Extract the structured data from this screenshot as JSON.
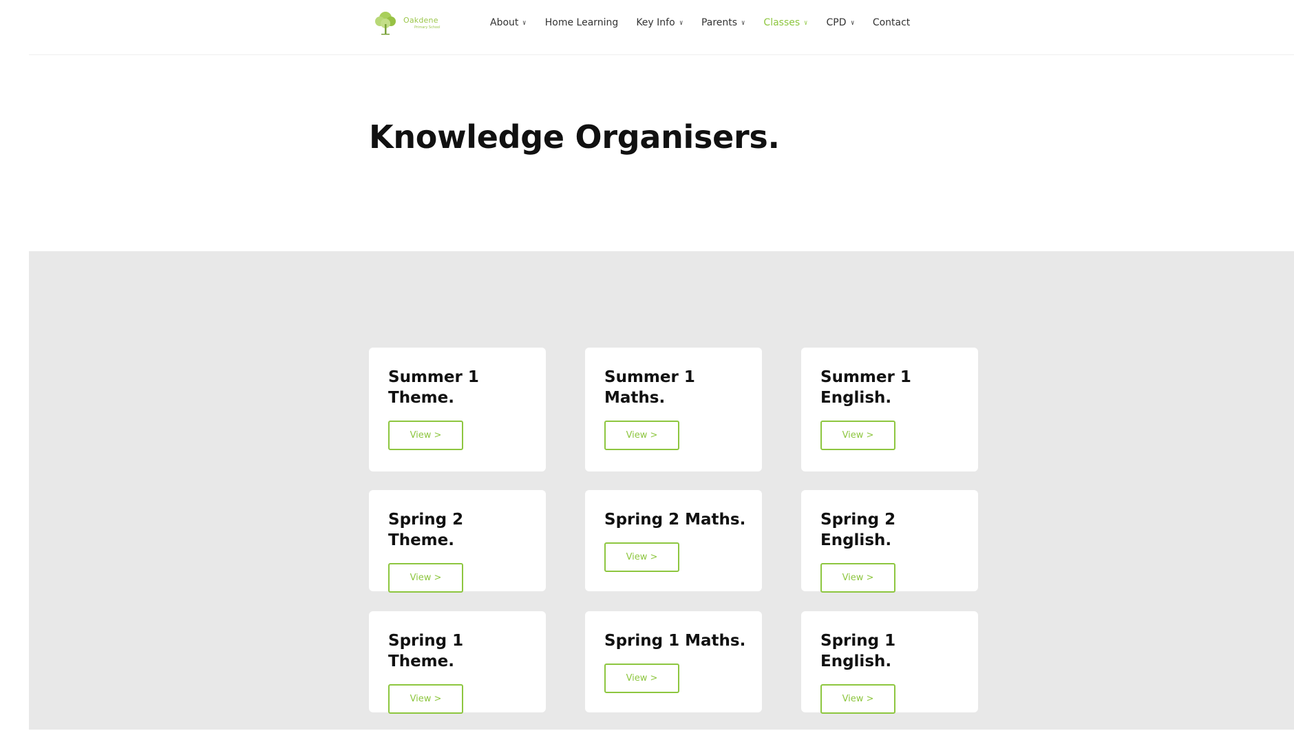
{
  "site": {
    "logo_name": "Oakdene",
    "logo_sub": "Primary School"
  },
  "nav": {
    "items": [
      {
        "label": "About",
        "has_dropdown": true,
        "active": false
      },
      {
        "label": "Home Learning",
        "has_dropdown": false,
        "active": false
      },
      {
        "label": "Key Info",
        "has_dropdown": true,
        "active": false
      },
      {
        "label": "Parents",
        "has_dropdown": true,
        "active": false
      },
      {
        "label": "Classes",
        "has_dropdown": true,
        "active": true
      },
      {
        "label": "CPD",
        "has_dropdown": true,
        "active": false
      },
      {
        "label": "Contact",
        "has_dropdown": false,
        "active": false
      }
    ]
  },
  "page": {
    "title": "Knowledge Organisers."
  },
  "cards": [
    {
      "title": "Summer 1 Theme.",
      "button": "View >"
    },
    {
      "title": "Summer 1 Maths.",
      "button": "View >"
    },
    {
      "title": "Summer 1 English.",
      "button": "View >"
    },
    {
      "title": "Spring 2 Theme.",
      "button": "View >"
    },
    {
      "title": "Spring 2 Maths.",
      "button": "View >"
    },
    {
      "title": "Spring 2 English.",
      "button": "View >"
    },
    {
      "title": "Spring 1 Theme.",
      "button": "View >"
    },
    {
      "title": "Spring 1 Maths.",
      "button": "View >"
    },
    {
      "title": "Spring 1 English.",
      "button": "View >"
    }
  ],
  "colors": {
    "accent": "#8dc63f",
    "band_background": "#e8e8e8",
    "card_background": "#ffffff",
    "text": "#111111"
  }
}
